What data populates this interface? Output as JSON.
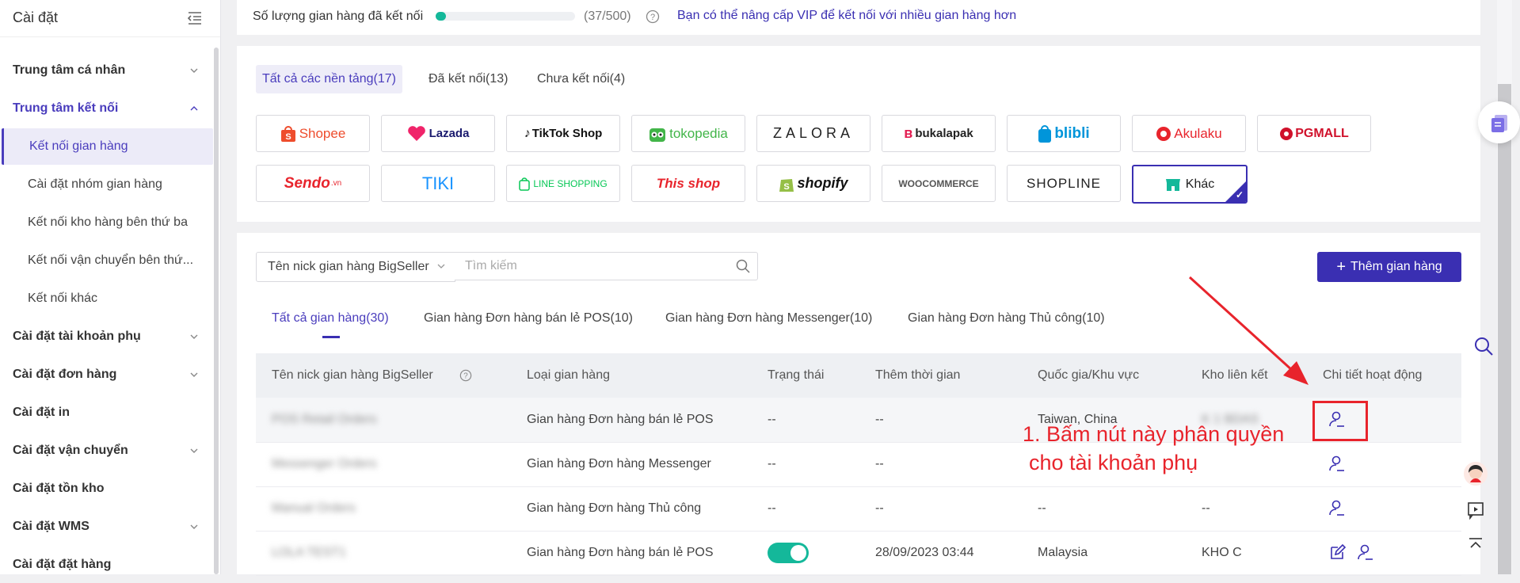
{
  "sidebar": {
    "title": "Cài đặt",
    "items": [
      {
        "label": "Trung tâm cá nhân"
      },
      {
        "label": "Trung tâm kết nối"
      },
      {
        "label": "Kết nối gian hàng"
      },
      {
        "label": "Cài đặt nhóm gian hàng"
      },
      {
        "label": "Kết nối kho hàng bên thứ ba"
      },
      {
        "label": "Kết nối vận chuyển bên thứ..."
      },
      {
        "label": "Kết nối khác"
      },
      {
        "label": "Cài đặt tài khoản phụ"
      },
      {
        "label": "Cài đặt đơn hàng"
      },
      {
        "label": "Cài đặt in"
      },
      {
        "label": "Cài đặt vận chuyển"
      },
      {
        "label": "Cài đặt tồn kho"
      },
      {
        "label": "Cài đặt WMS"
      },
      {
        "label": "Cài đặt đặt hàng"
      }
    ]
  },
  "connection": {
    "label": "Số lượng gian hàng đã kết nối",
    "count": "(37/500)",
    "progress": 0.074,
    "vip_link": "Bạn có thể nâng cấp VIP để kết nối với nhiều gian hàng hơn"
  },
  "platform_tabs": [
    {
      "label": "Tất cả các nền tảng(17)"
    },
    {
      "label": "Đã kết nối(13)"
    },
    {
      "label": "Chưa kết nối(4)"
    }
  ],
  "platforms": [
    {
      "name": "Shopee",
      "color": "#ee4d2d"
    },
    {
      "name": "Lazada",
      "color": "#1a1a6e"
    },
    {
      "name": "TikTok Shop",
      "color": "#111111"
    },
    {
      "name": "tokopedia",
      "color": "#42b549"
    },
    {
      "name": "ZALORA",
      "color": "#222222"
    },
    {
      "name": "bukalapak",
      "color": "#222222"
    },
    {
      "name": "blibli",
      "color": "#0095da"
    },
    {
      "name": "Akulaku",
      "color": "#e8242c"
    },
    {
      "name": "PGMALL",
      "color": "#d0112b"
    },
    {
      "name": "Sendo",
      "color": "#e8242c"
    },
    {
      "name": "TIKI",
      "color": "#1a94ff"
    },
    {
      "name": "LINE SHOPPING",
      "color": "#06c755"
    },
    {
      "name": "This shop",
      "color": "#e8242c"
    },
    {
      "name": "shopify",
      "color": "#111111"
    },
    {
      "name": "WOOCOMMERCE",
      "color": "#555555"
    },
    {
      "name": "SHOPLINE",
      "color": "#222222"
    },
    {
      "name": "Khác",
      "color": "#222222"
    }
  ],
  "filter": {
    "select_label": "Tên nick gian hàng BigSeller",
    "search_placeholder": "Tìm kiếm",
    "add_button": "Thêm gian hàng"
  },
  "store_tabs": [
    {
      "label": "Tất cả gian hàng(30)"
    },
    {
      "label": "Gian hàng Đơn hàng bán lẻ POS(10)"
    },
    {
      "label": "Gian hàng Đơn hàng Messenger(10)"
    },
    {
      "label": "Gian hàng Đơn hàng Thủ công(10)"
    }
  ],
  "table": {
    "headers": [
      "Tên nick gian hàng BigSeller",
      "Loại gian hàng",
      "Trạng thái",
      "Thêm thời gian",
      "Quốc gia/Khu vực",
      "Kho liên kết",
      "Chi tiết hoạt động"
    ],
    "rows": [
      {
        "name": "POS Retail Orders",
        "type": "Gian hàng Đơn hàng bán lẻ POS",
        "status": "--",
        "time": "--",
        "country": "Taiwan, China",
        "warehouse": "K 1 BDAS"
      },
      {
        "name": "Messenger Orders",
        "type": "Gian hàng Đơn hàng Messenger",
        "status": "--",
        "time": "--",
        "country": "",
        "warehouse": ""
      },
      {
        "name": "Manual Orders",
        "type": "Gian hàng Đơn hàng Thủ công",
        "status": "--",
        "time": "--",
        "country": "--",
        "warehouse": "--"
      },
      {
        "name": "LOLA TEST1",
        "type": "Gian hàng Đơn hàng bán lẻ POS",
        "status": "on",
        "time": "28/09/2023 03:44",
        "country": "Malaysia",
        "warehouse": "KHO C"
      }
    ]
  },
  "annotation": {
    "line1": "1. Bấm nút này phân quyền",
    "line2": "cho tài khoản phụ"
  }
}
